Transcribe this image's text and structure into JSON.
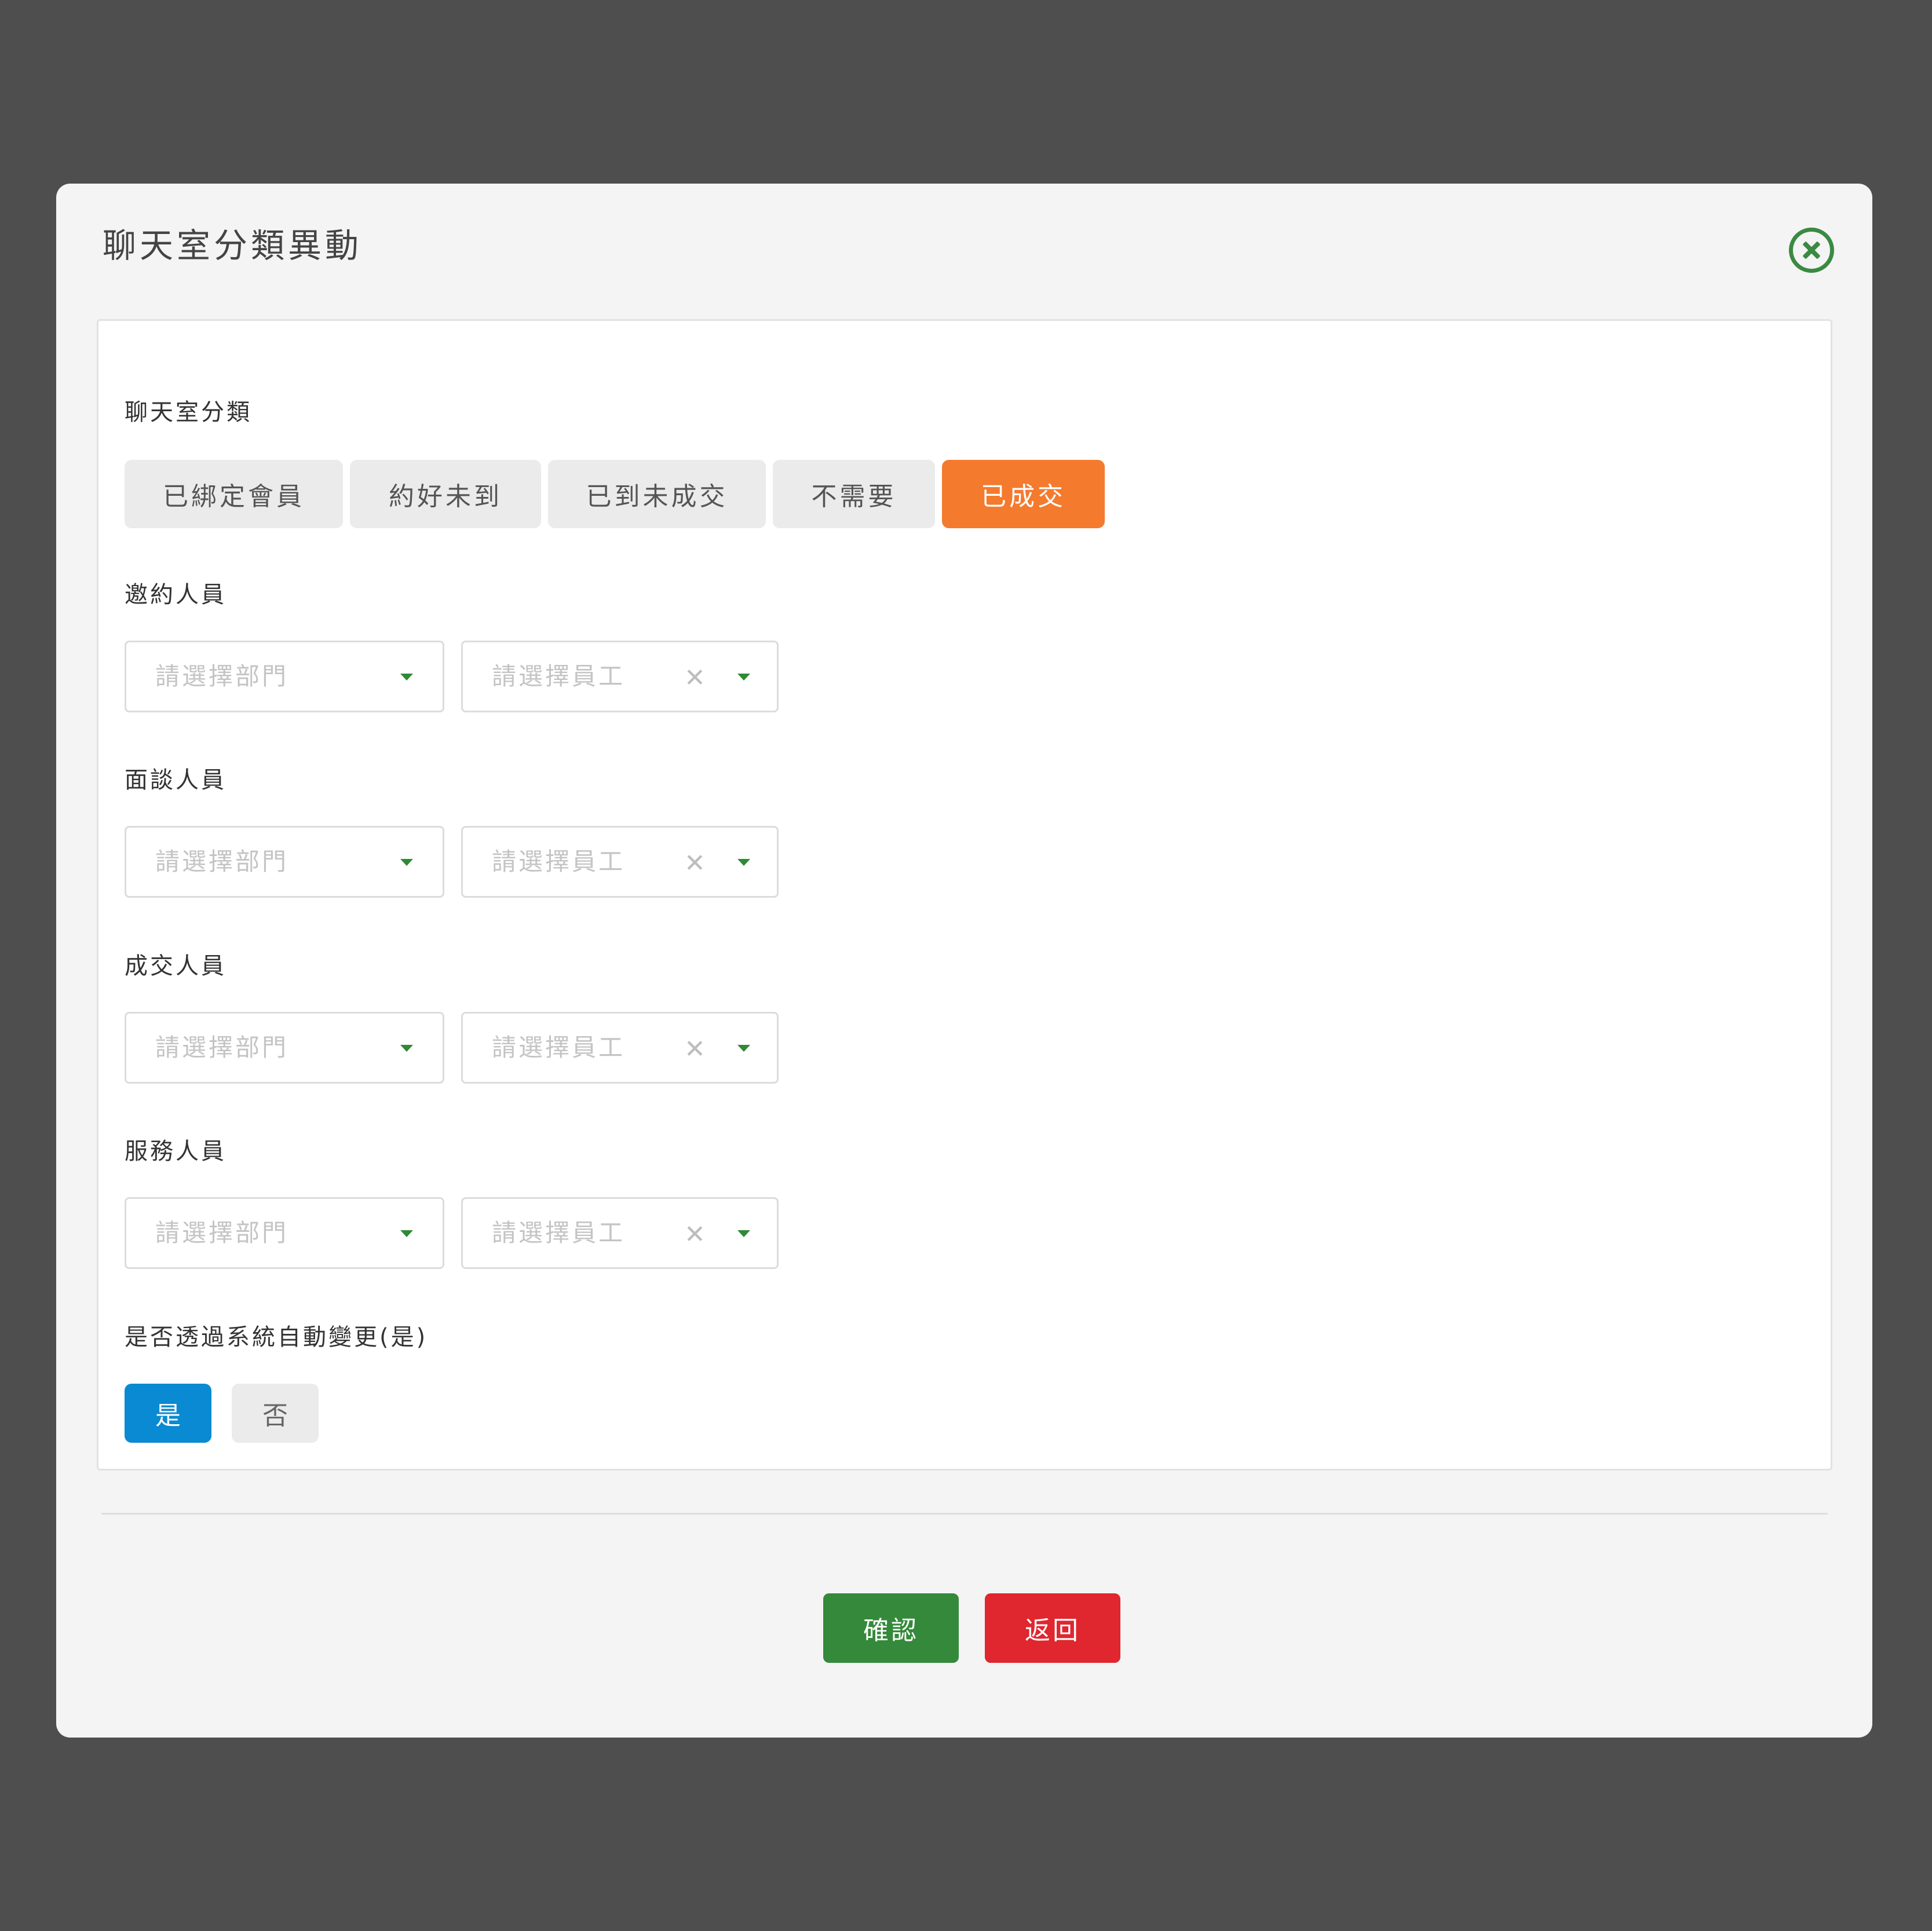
{
  "modal": {
    "title": "聊天室分類異動",
    "close_icon": "close-circle-icon"
  },
  "category": {
    "label": "聊天室分類",
    "options": [
      {
        "label": "已綁定會員",
        "active": false
      },
      {
        "label": "約好未到",
        "active": false
      },
      {
        "label": "已到未成交",
        "active": false
      },
      {
        "label": "不需要",
        "active": false
      },
      {
        "label": "已成交",
        "active": true
      }
    ]
  },
  "staff_groups": [
    {
      "label": "邀約人員",
      "dept_placeholder": "請選擇部門",
      "emp_placeholder": "請選擇員工"
    },
    {
      "label": "面談人員",
      "dept_placeholder": "請選擇部門",
      "emp_placeholder": "請選擇員工"
    },
    {
      "label": "成交人員",
      "dept_placeholder": "請選擇部門",
      "emp_placeholder": "請選擇員工"
    },
    {
      "label": "服務人員",
      "dept_placeholder": "請選擇部門",
      "emp_placeholder": "請選擇員工"
    }
  ],
  "auto_change": {
    "label": "是否透過系統自動變更(是)",
    "yes": "是",
    "no": "否",
    "selected": "是"
  },
  "footer": {
    "confirm": "確認",
    "back": "返回"
  },
  "colors": {
    "accent_active": "#f47a2e",
    "toggle_on": "#0a8ad2",
    "confirm": "#34893a",
    "back": "#e0262e",
    "dropdown_arrow": "#2f8a35"
  }
}
